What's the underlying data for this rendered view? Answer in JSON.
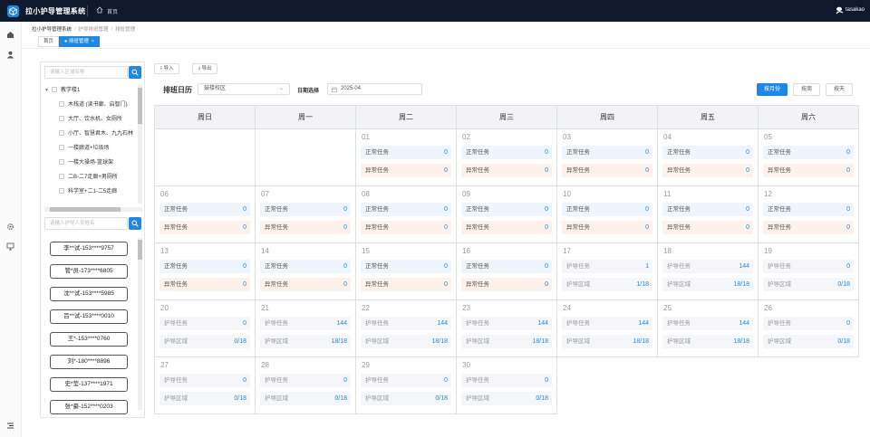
{
  "app": {
    "title": "拉小护导管理系统",
    "home": "首页",
    "user": "tasakao"
  },
  "breadcrumb": [
    "拉小护导管理系统",
    "护导排班管理",
    "排班管理"
  ],
  "tabs": [
    {
      "label": "首页"
    },
    {
      "label": "● 排班管理",
      "close": "×"
    }
  ],
  "left": {
    "area_search_placeholder": "请输入区域名称",
    "tree_root": "教学楼1",
    "tree_items": [
      "木栈道 (读书廊、启智门)",
      "大厅、饮水机、女厕所",
      "小厅、智慧君木、九九石林",
      "一楼廊道+垃圾场",
      "一楼大操场-篮球架",
      "二B-二7走廊+男厕所",
      "科学室+二1-二5走廊"
    ],
    "person_search_placeholder": "请输入护导人员姓名",
    "people": [
      "李**试-153****9757",
      "管*员-173****6805",
      "沈**试-153****5985",
      "吕**试-153****0010",
      "王*-153****0760",
      "刘*-180****8896",
      "史*莹-137****1971",
      "张*豪-152****0203"
    ]
  },
  "toolbar": {
    "import": "导入",
    "export": "导出",
    "schedule_label": "排班日历",
    "campus": "鼓楼校区",
    "date_label": "日期选择",
    "date_value": "2025-04",
    "by_month": "按月份",
    "by_week": "按周",
    "by_day": "按天"
  },
  "calendar": {
    "weekdays": [
      "周日",
      "周一",
      "周二",
      "周三",
      "周四",
      "周五",
      "周六"
    ],
    "days": [
      {
        "d": "01",
        "c": 2,
        "t": "n",
        "a": "0",
        "b": "0"
      },
      {
        "d": "02",
        "c": 3,
        "t": "n",
        "a": "0",
        "b": "0"
      },
      {
        "d": "03",
        "c": 4,
        "t": "n",
        "a": "0",
        "b": "0"
      },
      {
        "d": "04",
        "c": 5,
        "t": "n",
        "a": "0",
        "b": "0"
      },
      {
        "d": "05",
        "c": 6,
        "t": "n",
        "a": "0",
        "b": "0"
      },
      {
        "d": "06",
        "c": 0,
        "t": "n",
        "a": "0",
        "b": "0"
      },
      {
        "d": "07",
        "c": 1,
        "t": "n",
        "a": "0",
        "b": "0"
      },
      {
        "d": "08",
        "c": 2,
        "t": "n",
        "a": "0",
        "b": "0"
      },
      {
        "d": "09",
        "c": 3,
        "t": "n",
        "a": "0",
        "b": "0"
      },
      {
        "d": "10",
        "c": 4,
        "t": "n",
        "a": "0",
        "b": "0"
      },
      {
        "d": "11",
        "c": 5,
        "t": "n",
        "a": "0",
        "b": "0"
      },
      {
        "d": "12",
        "c": 6,
        "t": "n",
        "a": "0",
        "b": "0"
      },
      {
        "d": "13",
        "c": 0,
        "t": "n",
        "a": "0",
        "b": "0"
      },
      {
        "d": "14",
        "c": 1,
        "t": "n",
        "a": "0",
        "b": "0"
      },
      {
        "d": "15",
        "c": 2,
        "t": "n",
        "a": "0",
        "b": "0"
      },
      {
        "d": "16",
        "c": 3,
        "t": "n",
        "a": "0",
        "b": "0"
      },
      {
        "d": "17",
        "c": 4,
        "t": "g",
        "a": "1",
        "b": "1/18"
      },
      {
        "d": "18",
        "c": 5,
        "t": "g",
        "a": "144",
        "b": "18/18"
      },
      {
        "d": "19",
        "c": 6,
        "t": "g",
        "a": "0",
        "b": "0/18"
      },
      {
        "d": "20",
        "c": 0,
        "t": "g",
        "a": "0",
        "b": "0/18"
      },
      {
        "d": "21",
        "c": 1,
        "t": "g",
        "a": "144",
        "b": "18/18"
      },
      {
        "d": "22",
        "c": 2,
        "t": "g",
        "a": "144",
        "b": "18/18"
      },
      {
        "d": "23",
        "c": 3,
        "t": "g",
        "a": "144",
        "b": "18/18"
      },
      {
        "d": "24",
        "c": 4,
        "t": "g",
        "a": "144",
        "b": "18/18"
      },
      {
        "d": "25",
        "c": 5,
        "t": "g",
        "a": "144",
        "b": "18/18"
      },
      {
        "d": "26",
        "c": 6,
        "t": "g",
        "a": "0",
        "b": "0/18"
      },
      {
        "d": "27",
        "c": 0,
        "t": "g",
        "a": "0",
        "b": "0/18"
      },
      {
        "d": "28",
        "c": 1,
        "t": "g",
        "a": "0",
        "b": "0/18"
      },
      {
        "d": "29",
        "c": 2,
        "t": "g",
        "a": "0",
        "b": "0/18"
      },
      {
        "d": "30",
        "c": 3,
        "t": "g",
        "a": "0",
        "b": "0/18"
      }
    ],
    "labels": {
      "normal": "正常任务",
      "abnormal": "异常任务",
      "guard_task": "护导任务",
      "guard_area": "护导区域"
    }
  },
  "colors": {
    "accent": "#1e88e5",
    "topbar": "#0e1a2b"
  },
  "icons": {
    "logo": "cube-logo-icon",
    "home": "home-icon",
    "user": "user-avatar-icon",
    "search": "search-icon",
    "import": "upload-icon",
    "export": "download-icon",
    "calendar": "calendar-icon"
  }
}
